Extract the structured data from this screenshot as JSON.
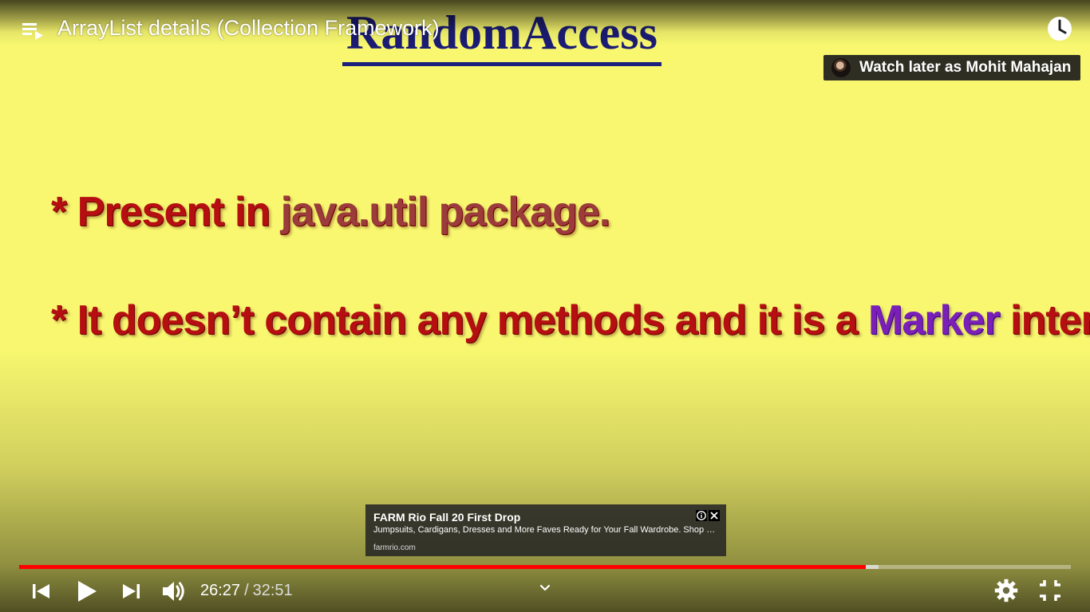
{
  "player": {
    "title": "ArrayList details (Collection Framework)",
    "watch_later_label": "Watch later as Mohit Mahajan",
    "progress_fraction": 0.805,
    "buffer_fraction": 0.817
  },
  "slide": {
    "brand": "RandomAccess",
    "line1_prefix": "* Present in ",
    "line1_java": "java.util package.",
    "line2_prefix": "* It doesn’t contain any methods and it is a ",
    "line2_marker": "Marker",
    "line2_suffix": " interface"
  },
  "ad": {
    "title": "FARM Rio Fall 20 First Drop",
    "description": "Jumpsuits, Cardigans, Dresses and More Faves Ready for Your Fall Wardrobe. Shop Now!",
    "url": "farmrio.com"
  },
  "controls": {
    "current_time": "26:27",
    "separator": "/",
    "duration": "32:51"
  },
  "icons": {
    "playlist": "playlist-icon",
    "clock": "clock-icon",
    "previous": "skip-previous-icon",
    "play": "play-icon",
    "next": "skip-next-icon",
    "volume": "volume-icon",
    "chevron": "chevron-down-icon",
    "settings": "gear-icon",
    "exit_fullscreen": "exit-fullscreen-icon",
    "info": "info-icon",
    "close": "close-icon"
  },
  "colors": {
    "slide_background": "#f8f76f",
    "brand_blue": "#1b1c74",
    "slide_red": "#b60f12",
    "java_red": "#9b3b3b",
    "marker_purple": "#7a1fb8",
    "progress_red": "#ff0000"
  }
}
